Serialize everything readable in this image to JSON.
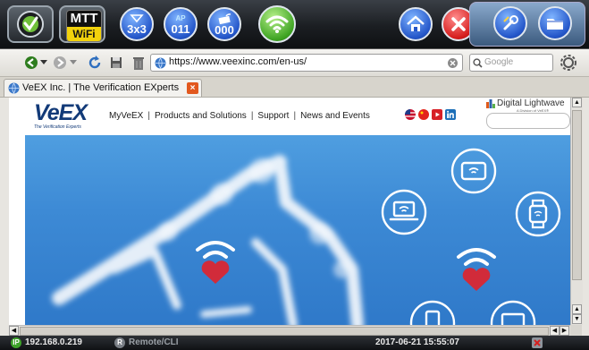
{
  "topbar": {
    "mtt_top": "MTT",
    "mtt_bottom": "WiFi",
    "mode_label": "3x3",
    "ap_count": "011",
    "ap_label": "AP",
    "client_count": "000"
  },
  "browser": {
    "url": "https://www.veexinc.com/en-us/",
    "search_placeholder": "Google",
    "tab_title": "VeEX Inc. | The Verification EXperts"
  },
  "site": {
    "logo_text": "VeEX",
    "logo_tagline": "The Verification Experts",
    "menu": [
      "MyVeEX",
      "Products and Solutions",
      "Support",
      "News and Events"
    ],
    "partner_name": "Digital Lightwave",
    "partner_sub": "A Division of VeEX®"
  },
  "status": {
    "ip_badge": "IP",
    "ip": "192.168.0.219",
    "remote_badge": "R",
    "remote": "Remote/CLI",
    "datetime": "2017-06-21  15:55:07"
  },
  "colors": {
    "accent_blue": "#2456c9",
    "wifi_green": "#3fa423",
    "close_red": "#d61d1d",
    "hero_sky": "#3d8ad5",
    "heart": "#d12b3a"
  }
}
